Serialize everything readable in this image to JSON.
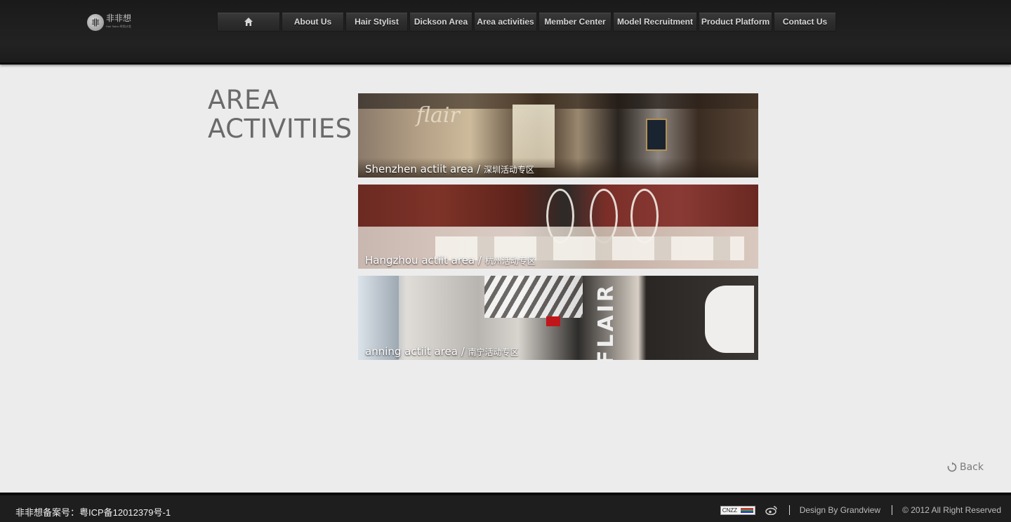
{
  "header": {
    "logo_text": "非非想",
    "logo_sub": "Hair Salon 时尚沙龙",
    "nav": [
      {
        "label": ""
      },
      {
        "label": "About Us"
      },
      {
        "label": "Hair Stylist"
      },
      {
        "label": "Dickson Area"
      },
      {
        "label": "Area activities"
      },
      {
        "label": "Member Center"
      },
      {
        "label": "Model Recruitment"
      },
      {
        "label": "Product Platform"
      },
      {
        "label": "Contact Us"
      }
    ],
    "home_icon": "home-icon"
  },
  "main": {
    "title_line1": "AREA",
    "title_line2": "ACTIVITIES",
    "banners": [
      {
        "caption_en": "Shenzhen actiit area / ",
        "caption_cn": "深圳活动专区",
        "photo_word": "flair"
      },
      {
        "caption_en": "Hangzhou actiit area / ",
        "caption_cn": "杭州活动专区"
      },
      {
        "caption_en": "anning actiit area / ",
        "caption_cn": "南宁活动专区",
        "photo_word": "FLAIR"
      }
    ],
    "back_label": "Back",
    "back_icon": "refresh-icon"
  },
  "footer": {
    "icp": "非非想备案号：粤ICP备12012379号-1",
    "cnzz_label": "CNZZ",
    "weibo_icon": "weibo-icon",
    "design_by": "Design By Grandview",
    "copyright": "© 2012 All Right Reserved"
  },
  "colors": {
    "header_bg": "#1f1f1f",
    "page_bg": "#ececec",
    "title": "#6a6a6a",
    "footer_bg": "#1e1e1e"
  }
}
